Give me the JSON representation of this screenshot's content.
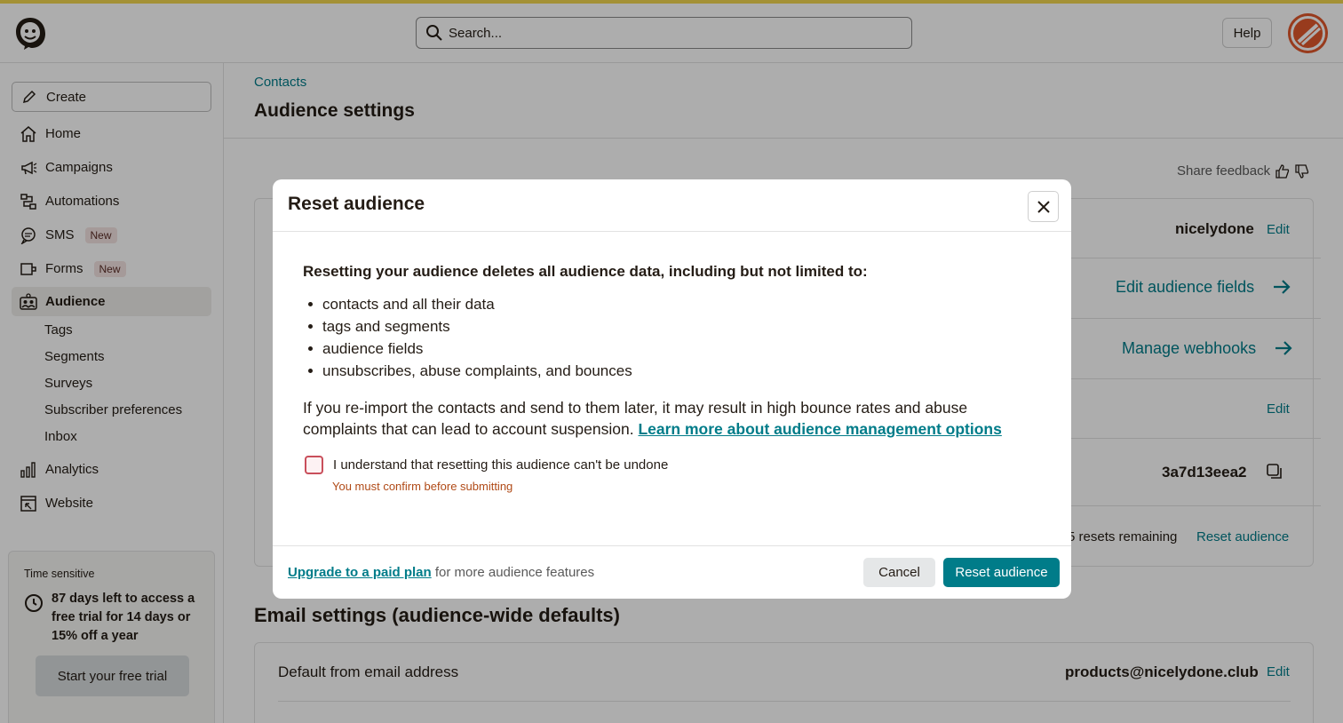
{
  "header": {
    "search_placeholder": "Search...",
    "help_label": "Help",
    "logo_icon": "mailchimp-freddie-icon",
    "avatar_color": "#e0572c"
  },
  "sidebar": {
    "create_label": "Create",
    "items": [
      {
        "label": "Home",
        "icon": "home-icon"
      },
      {
        "label": "Campaigns",
        "icon": "megaphone-icon"
      },
      {
        "label": "Automations",
        "icon": "automation-icon"
      },
      {
        "label": "SMS",
        "icon": "chat-icon",
        "badge": "New"
      },
      {
        "label": "Forms",
        "icon": "form-icon",
        "badge": "New"
      },
      {
        "label": "Audience",
        "icon": "audience-icon",
        "active": true
      },
      {
        "label": "Analytics",
        "icon": "bar-chart-icon"
      },
      {
        "label": "Website",
        "icon": "website-icon"
      }
    ],
    "audience_subitems": [
      "Tags",
      "Segments",
      "Surveys",
      "Subscriber preferences",
      "Inbox"
    ],
    "trial": {
      "label": "Time sensitive",
      "text": "87 days left to access a free trial for 14 days or 15% off a year",
      "button": "Start your free trial"
    }
  },
  "main": {
    "breadcrumb": "Contacts",
    "title": "Audience settings",
    "share_feedback": "Share feedback",
    "audience_name": "nicelydone",
    "edit_label": "Edit",
    "edit_fields_link": "Edit audience fields",
    "webhooks_link": "Manage webhooks",
    "audience_id": "3a7d13eea2",
    "resets_remaining": "5 resets remaining",
    "reset_audience_link": "Reset audience",
    "email_heading": "Email settings (audience-wide defaults)",
    "default_from_label": "Default from email address",
    "default_from_value": "products@nicelydone.club"
  },
  "modal": {
    "title": "Reset audience",
    "lead": "Resetting your audience deletes all audience data, including but not limited to:",
    "bullets": [
      "contacts and all their data",
      "tags and segments",
      "audience fields",
      "unsubscribes, abuse complaints, and bounces"
    ],
    "warning_text": "If you re-import the contacts and send to them later, it may result in high bounce rates and abuse complaints that can lead to account suspension.",
    "warning_link": "Learn more about audience management options",
    "checkbox_label": "I understand that resetting this audience can't be undone",
    "checkbox_error": "You must confirm before submitting",
    "footer_link": "Upgrade to a paid plan",
    "footer_suffix": "for more audience features",
    "cancel_label": "Cancel",
    "reset_label": "Reset audience"
  },
  "colors": {
    "accent": "#007c89",
    "error": "#b04a17",
    "topline": "#f2d650"
  }
}
